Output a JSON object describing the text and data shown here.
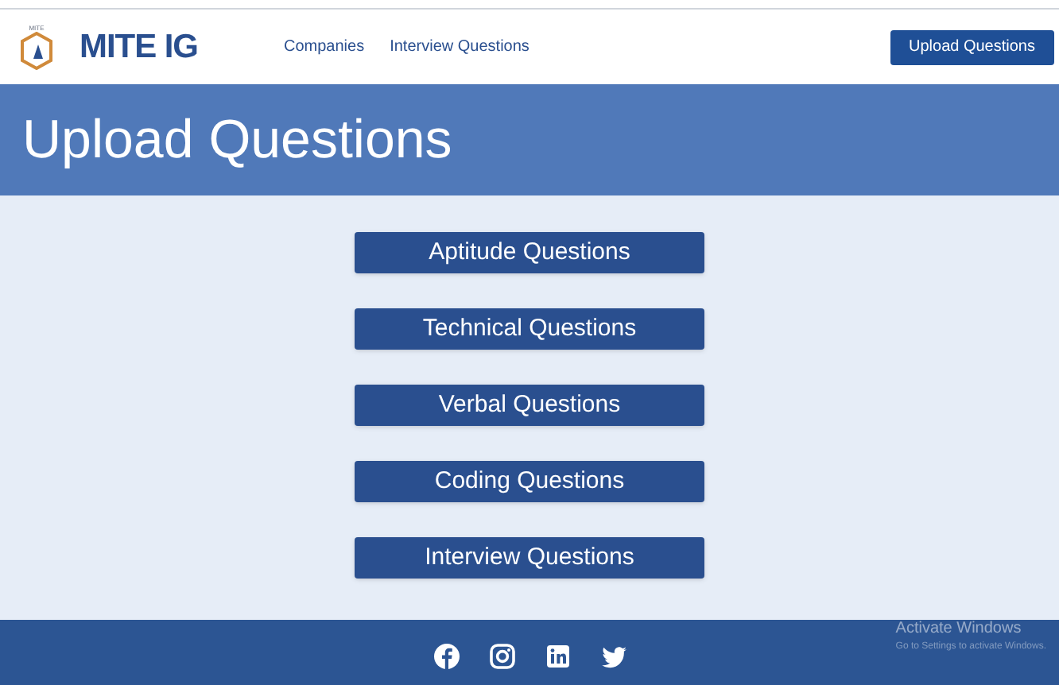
{
  "header": {
    "logo_caption": "MITE",
    "brand": "MITE IG",
    "nav": [
      {
        "label": "Companies"
      },
      {
        "label": "Interview Questions"
      }
    ],
    "action_button": "Upload Questions"
  },
  "page_title": "Upload Questions",
  "categories": [
    {
      "label": "Aptitude Questions"
    },
    {
      "label": "Technical Questions"
    },
    {
      "label": "Verbal Questions"
    },
    {
      "label": "Coding Questions"
    },
    {
      "label": "Interview Questions"
    }
  ],
  "footer": {
    "social": [
      {
        "kind": "facebook"
      },
      {
        "kind": "instagram"
      },
      {
        "kind": "linkedin"
      },
      {
        "kind": "twitter"
      }
    ]
  },
  "os_notice": {
    "title": "Activate Windows",
    "text": "Go to Settings to activate Windows."
  }
}
